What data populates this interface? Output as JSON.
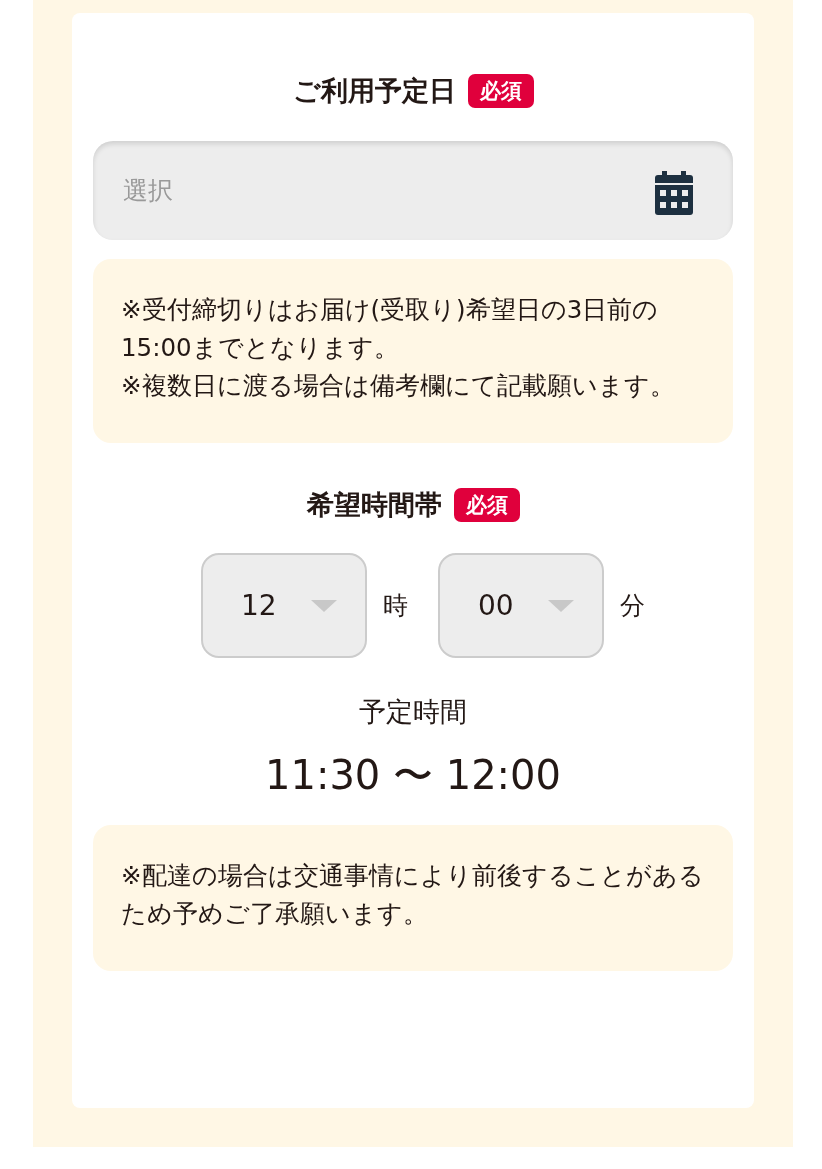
{
  "date_section": {
    "title": "ご利用予定日",
    "badge": "必須",
    "field": {
      "placeholder": "選択"
    },
    "notes": [
      "※受付締切りはお届け(受取り)希望日の3日前の15:00までとなります。",
      "※複数日に渡る場合は備考欄にて記載願います。"
    ]
  },
  "time_section": {
    "title": "希望時間帯",
    "badge": "必須",
    "selects": [
      {
        "value": "12",
        "unit": "時"
      },
      {
        "value": "00",
        "unit": "分"
      }
    ],
    "scheduled_label": "予定時間",
    "scheduled_range": "11:30 〜 12:00",
    "notes": [
      "※配達の場合は交通事情により前後することがあるため予めご了承願います。"
    ]
  }
}
